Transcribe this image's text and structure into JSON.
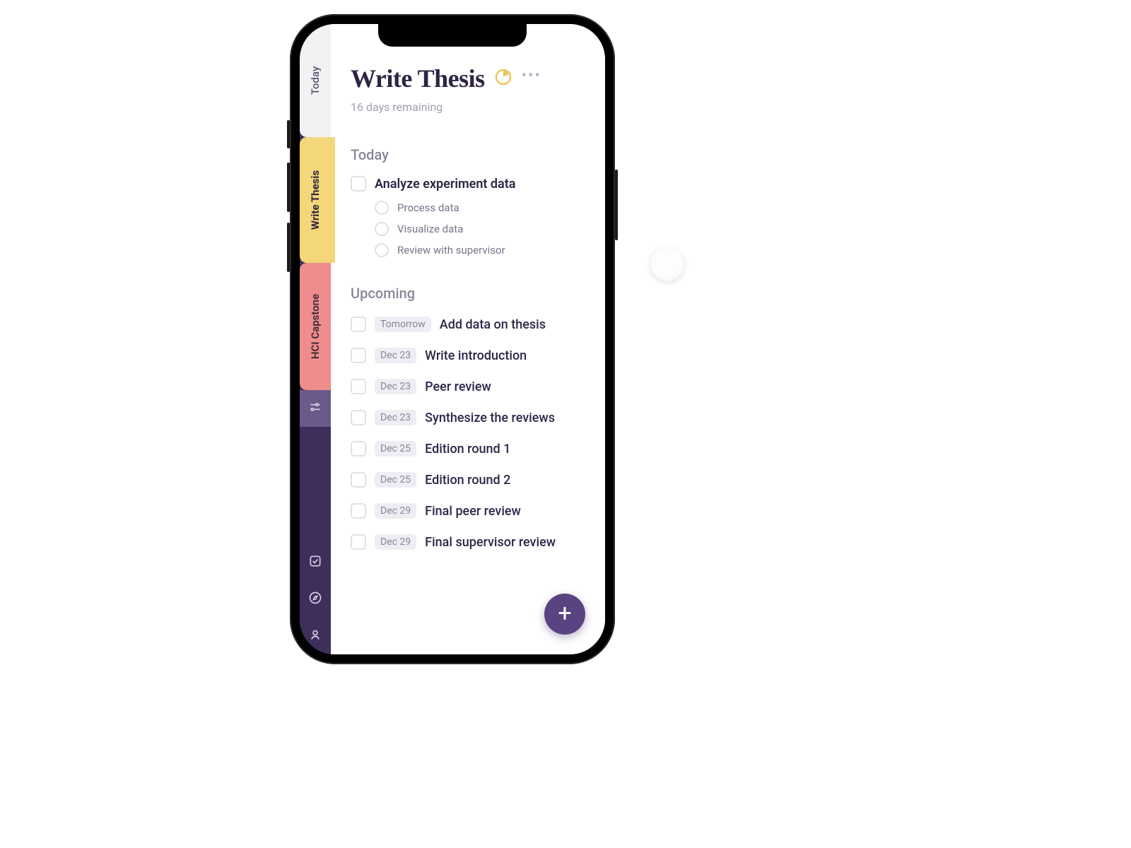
{
  "sidebar": {
    "tabs": [
      {
        "id": "today",
        "label": "Today"
      },
      {
        "id": "thesis",
        "label": "Write Thesis"
      },
      {
        "id": "capstone",
        "label": "HCI Capstone"
      }
    ]
  },
  "header": {
    "title": "Write Thesis",
    "subtitle": "16 days remaining"
  },
  "sections": {
    "today": {
      "heading": "Today",
      "task": {
        "label": "Analyze experiment data",
        "subtasks": [
          "Process data",
          "Visualize data",
          "Review with supervisor"
        ]
      }
    },
    "upcoming": {
      "heading": "Upcoming",
      "items": [
        {
          "date": "Tomorrow",
          "label": "Add data on thesis"
        },
        {
          "date": "Dec 23",
          "label": "Write introduction"
        },
        {
          "date": "Dec 23",
          "label": "Peer review"
        },
        {
          "date": "Dec 23",
          "label": "Synthesize the reviews"
        },
        {
          "date": "Dec 25",
          "label": "Edition round 1"
        },
        {
          "date": "Dec 25",
          "label": "Edition round 2"
        },
        {
          "date": "Dec 29",
          "label": "Final peer review"
        },
        {
          "date": "Dec 29",
          "label": "Final supervisor review"
        }
      ]
    }
  },
  "colors": {
    "accent": "#5a4381",
    "tab_today": "#f3f1f4",
    "tab_thesis": "#f3d77a",
    "tab_capstone": "#ef8d8d",
    "rail": "#3e2e5c"
  }
}
